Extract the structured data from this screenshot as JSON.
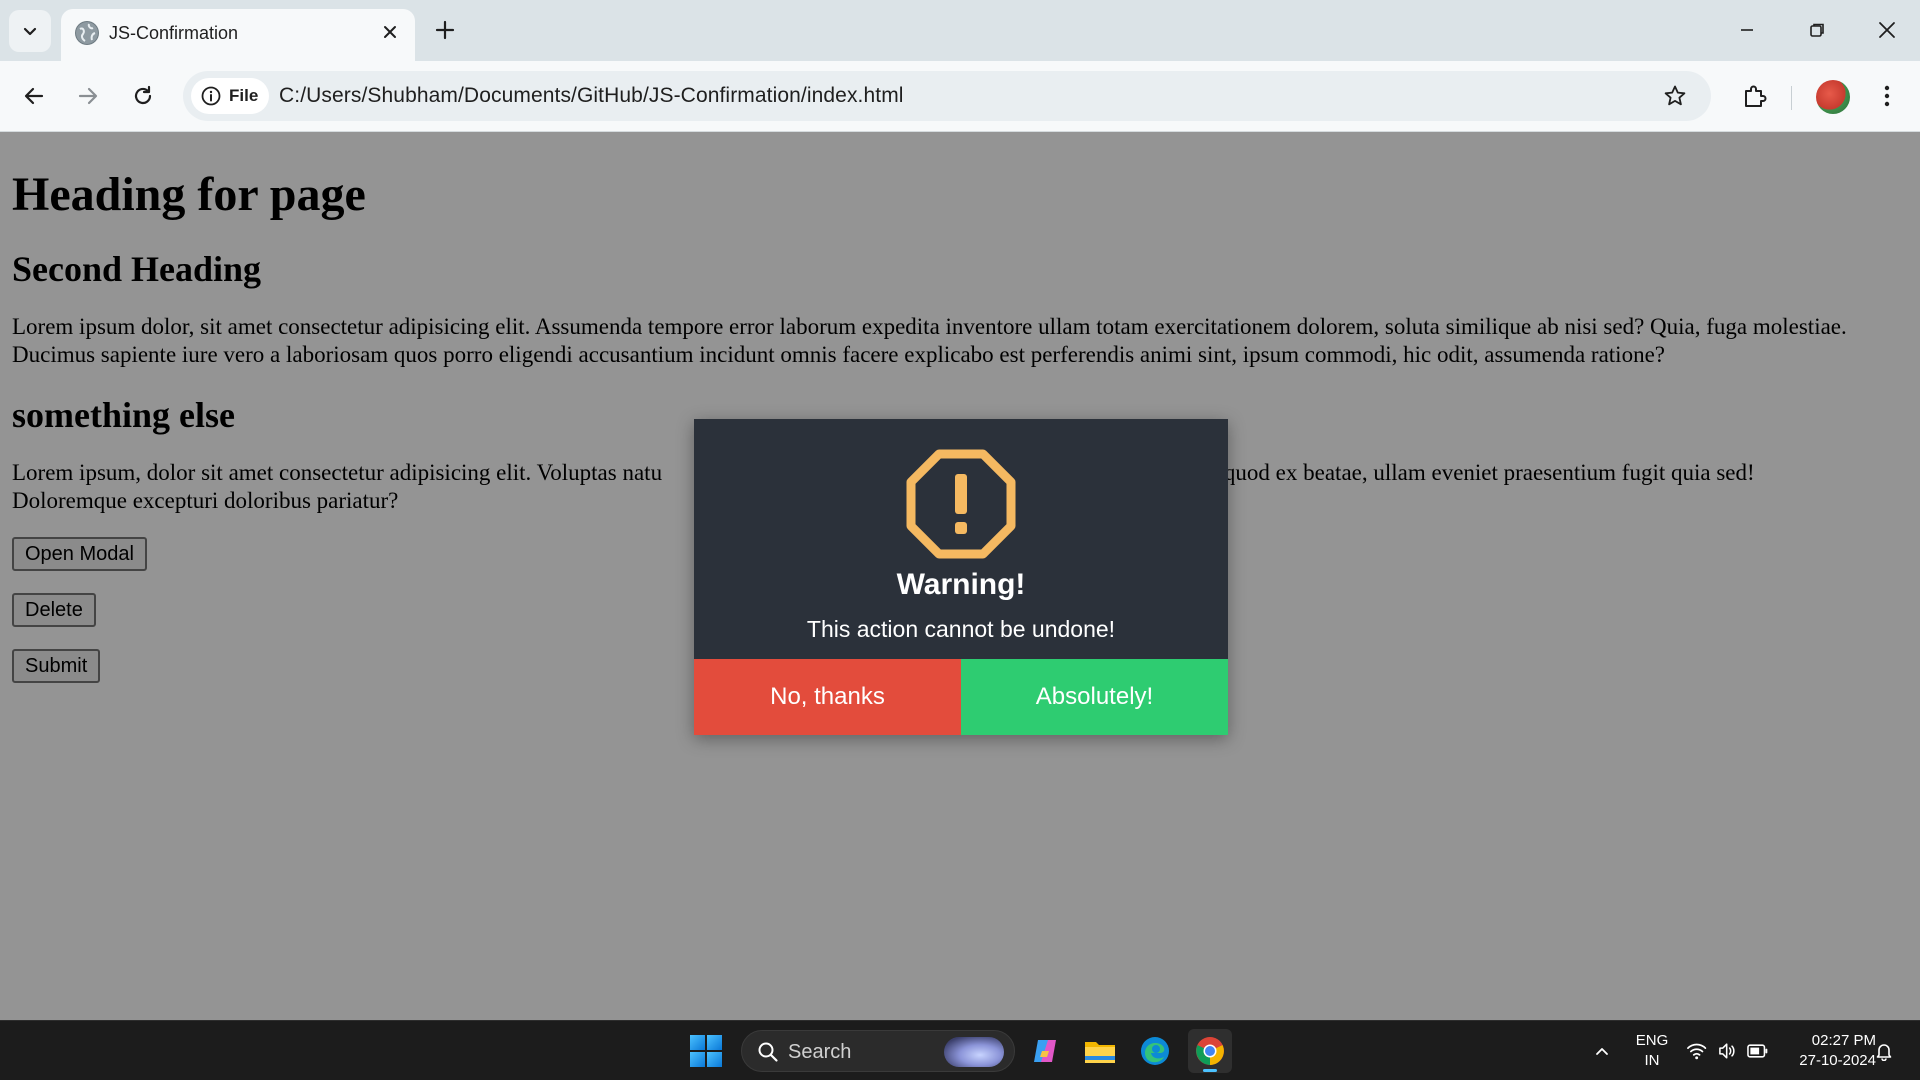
{
  "browser": {
    "tab": {
      "title": "JS-Confirmation"
    },
    "address_bar": {
      "site_chip_label": "File",
      "url": "C:/Users/Shubham/Documents/GitHub/JS-Confirmation/index.html"
    },
    "icons": [
      "tab-search-icon",
      "globe-icon",
      "close-icon",
      "plus-icon",
      "minimize-icon",
      "restore-icon",
      "close-window-icon",
      "back-arrow-icon",
      "forward-arrow-icon",
      "reload-icon",
      "info-icon",
      "star-icon",
      "extensions-icon",
      "avatar",
      "kebab-menu-icon"
    ]
  },
  "page": {
    "heading1": "Heading for page",
    "heading2": "Second Heading",
    "paragraph1": "Lorem ipsum dolor, sit amet consectetur adipisicing elit. Assumenda tempore error laborum expedita inventore ullam totam exercitationem dolorem, soluta similique ab nisi sed? Quia, fuga molestiae. Ducimus sapiente iure vero a laboriosam quos porro eligendi accusantium incidunt omnis facere explicabo est perferendis animi sint, ipsum commodi, hic odit, assumenda ratione?",
    "heading3": "something else",
    "paragraph2_visible_start": "Lorem ipsum, dolor sit amet consectetur adipisicing elit. Voluptas natu",
    "paragraph2_visible_end": "em quod ex beatae, ullam eveniet praesentium fugit quia sed!",
    "paragraph2_line2": "Doloremque excepturi doloribus pariatur?",
    "buttons": {
      "open_modal": "Open Modal",
      "delete": "Delete",
      "submit": "Submit"
    }
  },
  "modal": {
    "icon": "warning-exclamation-icon",
    "title": "Warning!",
    "message": "This action cannot be undone!",
    "cancel_label": "No, thanks",
    "confirm_label": "Absolutely!",
    "colors": {
      "background": "#2b313a",
      "icon": "#f5b961",
      "cancel": "#e34c3c",
      "confirm": "#2ecc71"
    }
  },
  "taskbar": {
    "search_label": "Search",
    "language": {
      "line1": "ENG",
      "line2": "IN"
    },
    "clock": {
      "time": "02:27 PM",
      "date": "27-10-2024"
    },
    "apps": [
      "start-icon",
      "copilot-icon",
      "file-explorer-icon",
      "edge-icon",
      "chrome-icon"
    ],
    "tray": [
      "chevron-up-icon",
      "wifi-icon",
      "volume-icon",
      "battery-icon",
      "notification-bell-icon"
    ]
  }
}
